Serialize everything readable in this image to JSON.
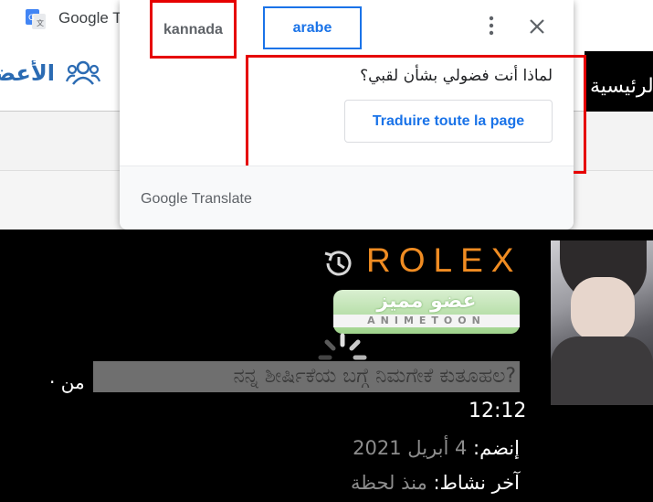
{
  "browser": {
    "tab_title": "Google T"
  },
  "site_nav": {
    "members_label": "الأعضاء",
    "home_label": "الرئيسية"
  },
  "translate_popup": {
    "source_language": "kannada",
    "target_language": "arabe",
    "question": "لماذا أنت فضولي بشأن لقبي؟",
    "translate_button": "Traduire toute la page",
    "footer_brand": "Google Translate"
  },
  "profile": {
    "username": "ROLEX",
    "badge_text_ar": "عضو مميز",
    "badge_text_en": "ANIMETOON",
    "from_label": "· من",
    "title_text": "ನನ್ನ ಶೀರ್ಷಿಕೆಯ ಬಗ್ಗೆ ನಿಮಗೇಕೆ ಕುತೂಹಲ?",
    "time": "12:12",
    "joined_label": "إنضم:",
    "joined_value": "4 أبريل 2021",
    "last_active_label": "آخر نشاط:",
    "last_active_value": "منذ لحظة"
  },
  "colors": {
    "accent_blue": "#1a73e8",
    "highlight_red": "#e60000",
    "username_orange": "#f08c22"
  }
}
